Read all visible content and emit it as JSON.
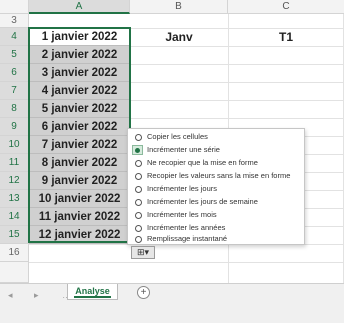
{
  "columns": [
    "A",
    "B",
    "C"
  ],
  "rows": [
    "3",
    "4",
    "5",
    "6",
    "7",
    "8",
    "9",
    "10",
    "11",
    "12",
    "13",
    "14",
    "15",
    "16"
  ],
  "column_a_values": [
    "1 janvier 2022",
    "2 janvier 2022",
    "3 janvier 2022",
    "4 janvier 2022",
    "5 janvier 2022",
    "6 janvier 2022",
    "7 janvier 2022",
    "8 janvier 2022",
    "9 janvier 2022",
    "10 janvier 2022",
    "11 janvier 2022",
    "12 janvier 2022"
  ],
  "cell_b4": "Janv",
  "cell_c4": "T1",
  "autofill_menu": {
    "items": [
      {
        "label": "Copier les cellules",
        "checked": false
      },
      {
        "label": "Incrémenter une série",
        "checked": true
      },
      {
        "label": "Ne recopier que la mise en forme",
        "checked": false
      },
      {
        "label": "Recopier les valeurs sans la mise en forme",
        "checked": false
      },
      {
        "label": "Incrémenter les jours",
        "checked": false
      },
      {
        "label": "Incrémenter les jours de semaine",
        "checked": false
      },
      {
        "label": "Incrémenter les mois",
        "checked": false
      },
      {
        "label": "Incrémenter les années",
        "checked": false
      },
      {
        "label": "Remplissage instantané",
        "checked": false
      }
    ]
  },
  "autofill_button": {
    "icon": "autofill-options-icon",
    "glyph": "⊞▾"
  },
  "sheet_tabs": {
    "active": "Analyse",
    "add_glyph": "+",
    "nav_prev": "◂",
    "nav_next": "▸",
    "separator": "…"
  },
  "colors": {
    "accent": "#217346",
    "selection_fill": "#d0d0d0"
  }
}
